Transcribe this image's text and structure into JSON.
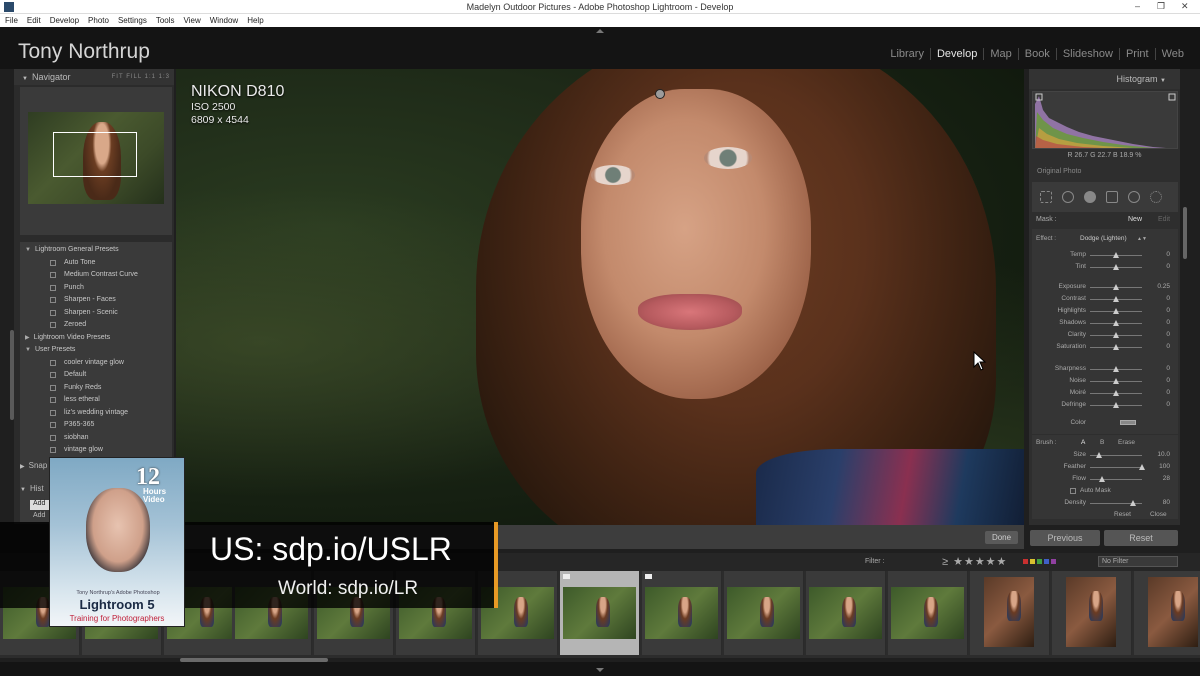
{
  "window": {
    "title": "Madelyn Outdoor Pictures - Adobe Photoshop Lightroom - Develop"
  },
  "menu": [
    "File",
    "Edit",
    "Develop",
    "Photo",
    "Settings",
    "Tools",
    "View",
    "Window",
    "Help"
  ],
  "identity_plate": "Tony Northrup",
  "modules": [
    "Library",
    "Develop",
    "Map",
    "Book",
    "Slideshow",
    "Print",
    "Web"
  ],
  "active_module": "Develop",
  "left_panel": {
    "navigator_label": "Navigator",
    "zoom_options": "FIT  FILL  1:1  1:3",
    "presets": [
      {
        "type": "folder",
        "label": "Lightroom General Presets"
      },
      {
        "type": "item",
        "label": "Auto Tone"
      },
      {
        "type": "item",
        "label": "Medium Contrast Curve"
      },
      {
        "type": "item",
        "label": "Punch"
      },
      {
        "type": "item",
        "label": "Sharpen - Faces"
      },
      {
        "type": "item",
        "label": "Sharpen - Scenic"
      },
      {
        "type": "item",
        "label": "Zeroed"
      },
      {
        "type": "folder",
        "label": "Lightroom Video Presets"
      },
      {
        "type": "folder",
        "label": "User Presets"
      },
      {
        "type": "item",
        "label": "cooler vintage glow"
      },
      {
        "type": "item",
        "label": "Default"
      },
      {
        "type": "item",
        "label": "Funky Reds"
      },
      {
        "type": "item",
        "label": "less etheral"
      },
      {
        "type": "item",
        "label": "liz's wedding vintage"
      },
      {
        "type": "item",
        "label": "P365-365"
      },
      {
        "type": "item",
        "label": "siobhan"
      },
      {
        "type": "item",
        "label": "vintage glow"
      }
    ],
    "snapshots_label": "Snap",
    "history_label": "Hist",
    "history_rows": [
      "Add",
      "Add"
    ]
  },
  "photo_info": {
    "camera": "NIKON D810",
    "iso": "ISO 2500",
    "dimensions": "6809 x 4544"
  },
  "right_panel": {
    "histogram_label": "Histogram",
    "rgb_readout": "R  26.7  G  22.7  B  18.9  %",
    "original_photo_label": "Original Photo",
    "mask_label": "Mask :",
    "mask_new": "New",
    "mask_edit": "Edit",
    "effect_label": "Effect :",
    "effect_value": "Dodge (Lighten)",
    "sliders": [
      {
        "label": "Temp",
        "value": "0"
      },
      {
        "label": "Tint",
        "value": "0"
      },
      {
        "label": "Exposure",
        "value": "0.25"
      },
      {
        "label": "Contrast",
        "value": "0"
      },
      {
        "label": "Highlights",
        "value": "0"
      },
      {
        "label": "Shadows",
        "value": "0"
      },
      {
        "label": "Clarity",
        "value": "0"
      },
      {
        "label": "Saturation",
        "value": "0"
      },
      {
        "label": "Sharpness",
        "value": "0"
      },
      {
        "label": "Noise",
        "value": "0"
      },
      {
        "label": "Moiré",
        "value": "0"
      },
      {
        "label": "Defringe",
        "value": "0"
      }
    ],
    "color_label": "Color",
    "brush": {
      "label": "Brush :",
      "tabs": [
        "A",
        "B",
        "Erase"
      ],
      "rows": [
        {
          "label": "Size",
          "value": "10.0"
        },
        {
          "label": "Feather",
          "value": "100"
        },
        {
          "label": "Flow",
          "value": "28"
        }
      ],
      "auto_mask": "Auto Mask",
      "density_label": "Density",
      "density_value": "80",
      "reset": "Reset",
      "close": "Close"
    },
    "previous_button": "Previous",
    "reset_button": "Reset"
  },
  "toolbar": {
    "done_label": "Done"
  },
  "filmstrip": {
    "filter_label": "Filter :",
    "stars": "≥ ★★★★★",
    "label_colors": [
      "#c83030",
      "#d8c030",
      "#40a040",
      "#4060c8",
      "#9040a0"
    ],
    "no_filter": "No Filter"
  },
  "promo": {
    "us_url": "US: sdp.io/USLR",
    "world_url": "World: sdp.io/LR",
    "accent_color": "#e89a25",
    "book": {
      "hours": "12",
      "hours_sub": "Hours Video",
      "byline": "Tony Northrup's Adobe Photoshop",
      "title": "Lightroom 5",
      "subtitle": "Training for Photographers"
    }
  }
}
